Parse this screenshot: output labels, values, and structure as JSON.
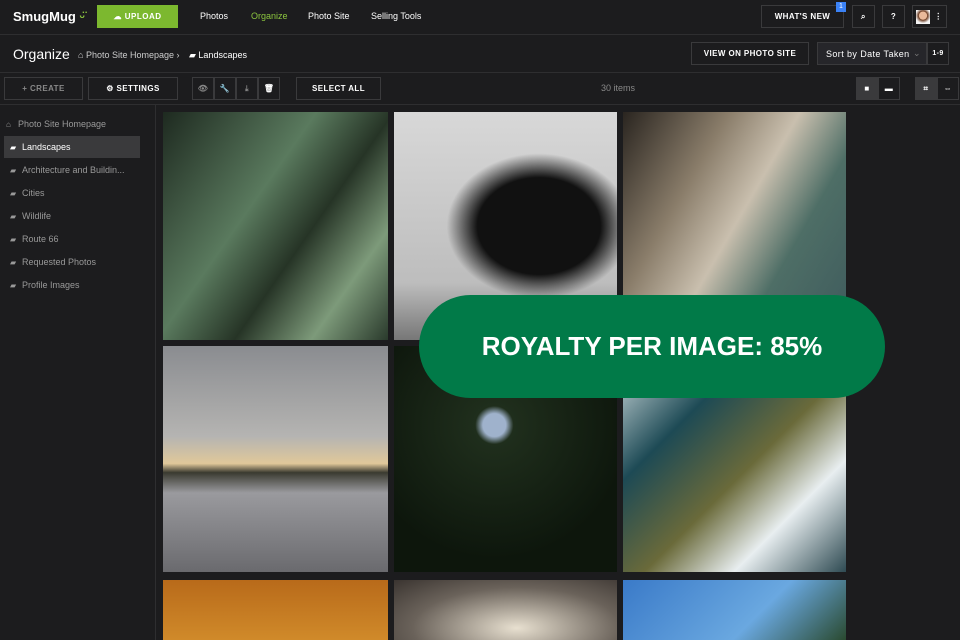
{
  "header": {
    "logo": "SmugMug",
    "upload": "UPLOAD",
    "nav": [
      "Photos",
      "Organize",
      "Photo Site",
      "Selling Tools"
    ],
    "whats_new": "WHAT'S NEW",
    "badge": "1"
  },
  "subheader": {
    "title": "Organize",
    "breadcrumb": [
      "Photo Site Homepage",
      "Landscapes"
    ],
    "view_site": "VIEW ON PHOTO SITE",
    "sort": "Sort by Date Taken",
    "sort_dir": "1-9"
  },
  "toolbar": {
    "create": "CREATE",
    "settings": "SETTINGS",
    "select_all": "SELECT ALL",
    "count": "30 items"
  },
  "sidebar": {
    "items": [
      "Photo Site Homepage",
      "Landscapes",
      "Architecture and Buildin...",
      "Cities",
      "Wildlife",
      "Route 66",
      "Requested Photos",
      "Profile Images"
    ]
  },
  "overlay": {
    "text": "ROYALTY PER IMAGE: 85%"
  },
  "colors": {
    "accent": "#7cb82f",
    "overlay": "#017a48"
  }
}
